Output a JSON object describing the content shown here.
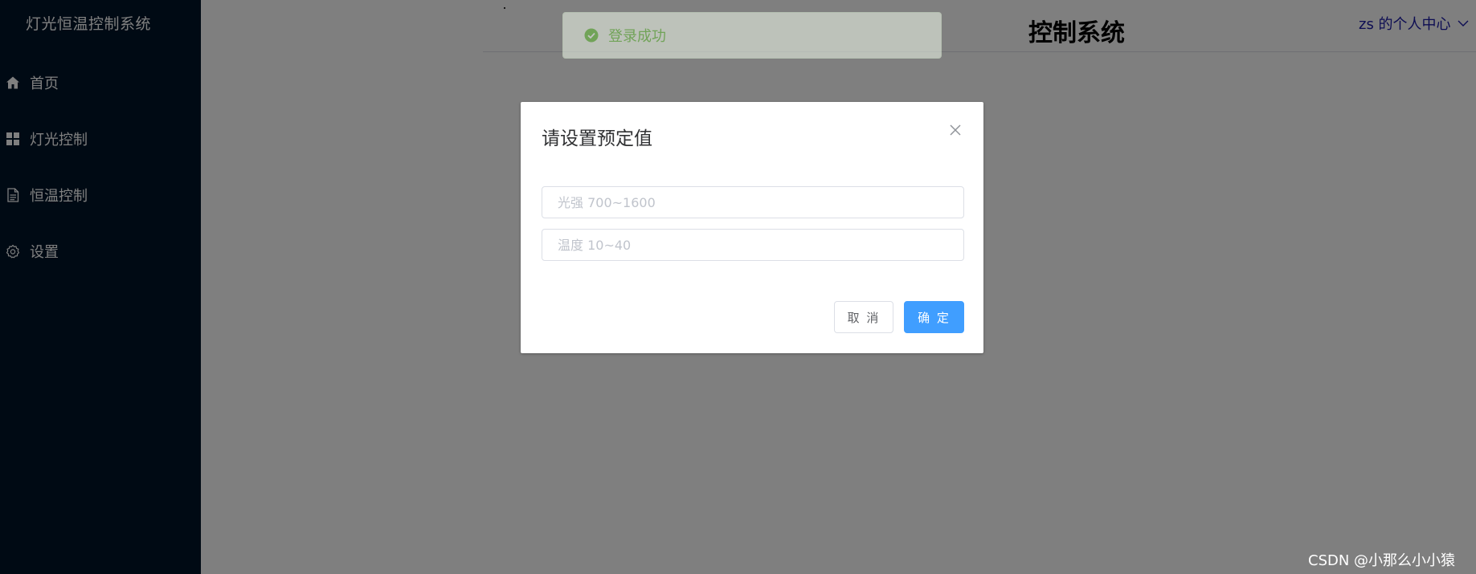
{
  "sidebar": {
    "title": "灯光恒温控制系统",
    "items": [
      {
        "label": "首页",
        "icon": "home-icon"
      },
      {
        "label": "灯光控制",
        "icon": "grid-icon"
      },
      {
        "label": "恒温控制",
        "icon": "document-icon"
      },
      {
        "label": "设置",
        "icon": "gear-icon"
      }
    ]
  },
  "header": {
    "title_visible": "控制系统",
    "user_center": "zs 的个人中心"
  },
  "toast": {
    "message": "登录成功",
    "icon": "check-circle-icon"
  },
  "dialog": {
    "title": "请设置预定值",
    "light_placeholder": "光强 700~1600",
    "temp_placeholder": "温度 10~40",
    "cancel_label": "取 消",
    "ok_label": "确 定"
  },
  "watermark": "CSDN @小那么小小猿",
  "colors": {
    "sidebar_bg": "#001529",
    "primary": "#409eff",
    "success": "#67c23a"
  }
}
